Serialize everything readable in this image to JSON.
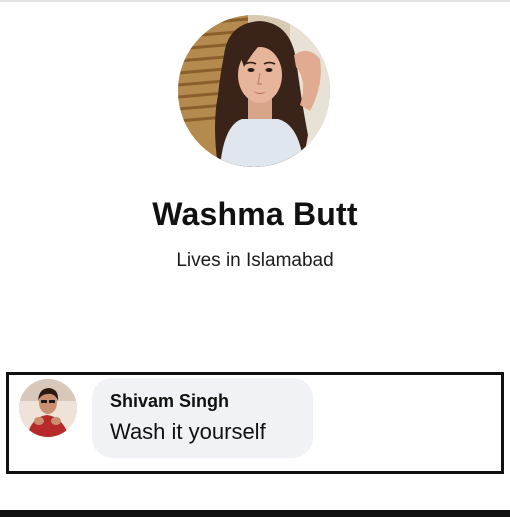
{
  "profile": {
    "photo_icon": "profile-photo",
    "name": "Washma Butt",
    "location": "Lives in Islamabad"
  },
  "comment": {
    "avatar_icon": "commenter-avatar",
    "author": "Shivam Singh",
    "text": "Wash it yourself",
    "bubble_color": "#f0f2f5",
    "frame_color": "#111111"
  }
}
